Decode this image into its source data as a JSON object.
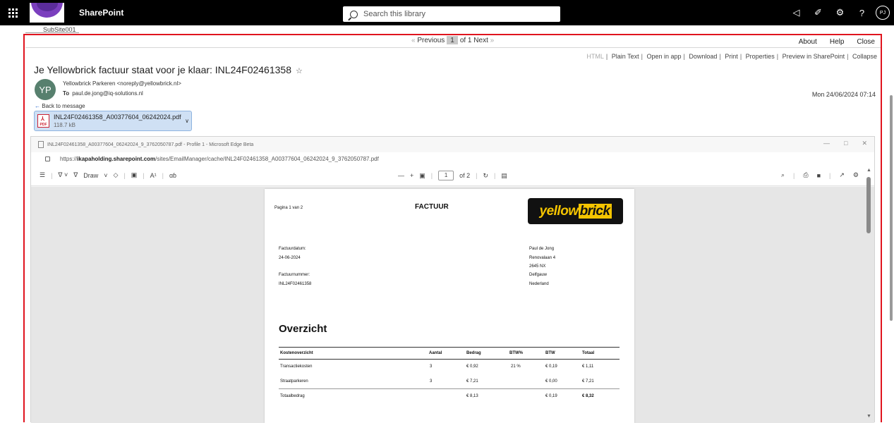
{
  "suitebar": {
    "brand": "SharePoint",
    "search_placeholder": "Search this library",
    "avatar_initials": "PJ",
    "icons": [
      "app-launcher-icon",
      "megaphone-icon",
      "feedback-icon",
      "gear-icon",
      "help-icon"
    ]
  },
  "breadcrumb": {
    "site": "SubSite001"
  },
  "pager": {
    "previous": "Previous",
    "current": "1",
    "of_label": "of 1",
    "next": "Next"
  },
  "top_links": [
    "About",
    "Help",
    "Close"
  ],
  "view_links": [
    "HTML",
    "Plain Text",
    "Open in app",
    "Download",
    "Print",
    "Properties",
    "Preview in SharePoint",
    "Collapse"
  ],
  "message": {
    "subject": "Je Yellowbrick factuur staat voor je klaar: INL24F02461358",
    "sender_initials": "YP",
    "from": "Yellowbrick Parkeren <noreply@yellowbrick.nl>",
    "to_label": "To",
    "to": "paul.de.jong@iq-solutions.nl",
    "date": "Mon 24/06/2024 07:14",
    "back_link": "Back to message"
  },
  "attachment": {
    "name": "INL24F02461358_A00377604_06242024.pdf",
    "size": "118.7 kB",
    "icon": "pdf-file-icon"
  },
  "browser": {
    "title": "INL24F02461358_A00377604_06242024_9_3762050787.pdf - Profile 1 - Microsoft Edge Beta",
    "url_prefix": "https://",
    "url_host": "ikapaholding.sharepoint.com",
    "url_path": "/sites/EmailManager/cache/INL24F02461358_A00377604_06242024_9_3762050787.pdf",
    "draw_label": "Draw",
    "page_input": "1",
    "page_total": "of 2"
  },
  "invoice": {
    "page_label": "Pagina 1 van 2",
    "heading": "FACTUUR",
    "logo_text_1": "yellow",
    "logo_text_2": "brick",
    "date_label": "Factuurdatum:",
    "date_value": "24-06-2024",
    "number_label": "Factuurnummer:",
    "number_value": "INL24F02461358",
    "address": [
      "Paul de Jong",
      "Renovalaan 4",
      "2645 NX",
      "Delfgauw",
      "Nederland"
    ],
    "section_title": "Overzicht",
    "table": {
      "headers": [
        "Kostenoverzicht",
        "Aantal",
        "Bedrag",
        "BTW%",
        "BTW",
        "Totaal"
      ],
      "rows": [
        [
          "Transactiekosten",
          "3",
          "€ 0,92",
          "21 %",
          "€ 0,19",
          "€ 1,11"
        ],
        [
          "Straatparkeren",
          "3",
          "€ 7,21",
          "",
          "€ 0,00",
          "€ 7,21"
        ]
      ],
      "total": [
        "Totaalbedrag",
        "",
        "€ 8,13",
        "",
        "€ 0,19",
        "€ 8,32"
      ]
    }
  }
}
